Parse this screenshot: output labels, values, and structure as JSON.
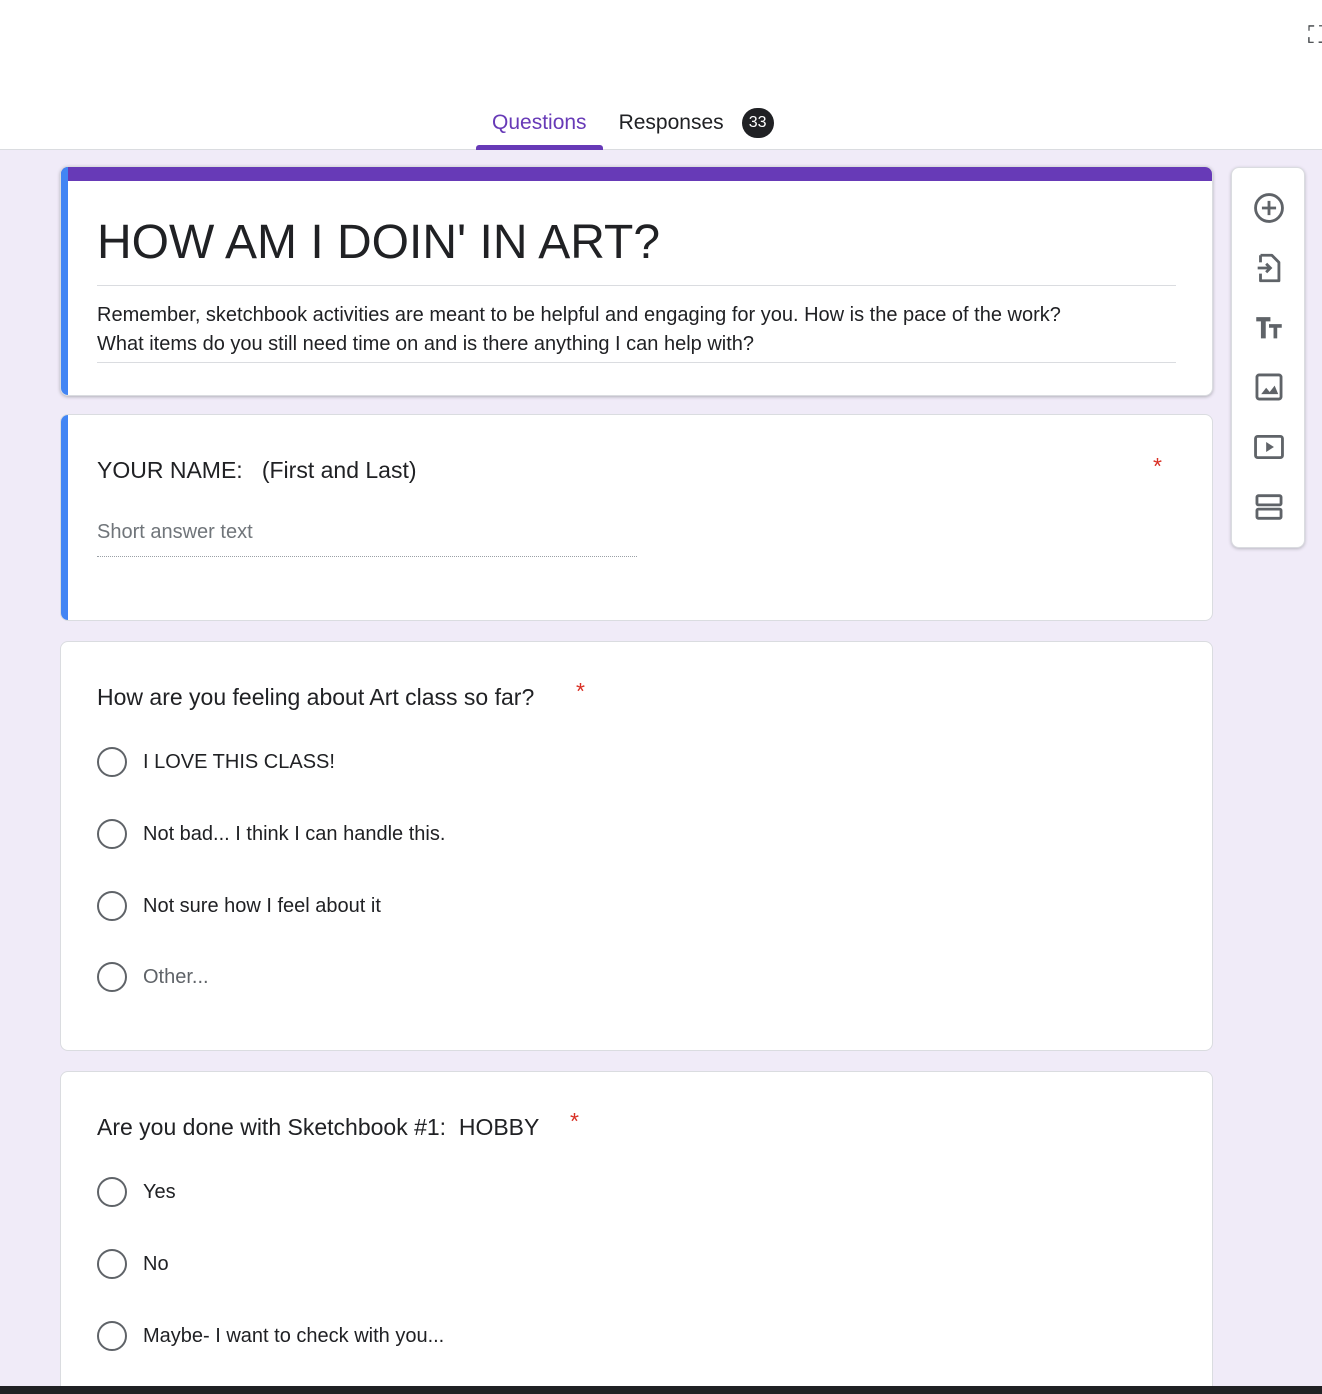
{
  "tabs": {
    "questions": "Questions",
    "responses": "Responses",
    "responses_count": "33"
  },
  "form": {
    "title": "HOW AM I DOIN' IN ART?",
    "description_line1": "Remember, sketchbook activities are meant to be helpful and engaging for you. How is the pace of the work?",
    "description_line2": "What items do you still need time on and is there anything I can help with?"
  },
  "questions": [
    {
      "title": "YOUR NAME:   (First and Last)",
      "required_mark": "*",
      "placeholder": "Short answer text"
    },
    {
      "title": "How are you feeling about Art class so far?",
      "required_mark": "*",
      "options": [
        "I LOVE THIS CLASS!",
        "Not bad... I think I can handle this.",
        "Not sure how I feel about it",
        "Other..."
      ]
    },
    {
      "title": "Are you done with Sketchbook #1:  HOBBY",
      "required_mark": "*",
      "options": [
        "Yes",
        "No",
        "Maybe- I want to check with you..."
      ]
    }
  ],
  "toolbar_icons": [
    "add-question-icon",
    "import-questions-icon",
    "add-title-icon",
    "add-image-icon",
    "add-video-icon",
    "add-section-icon"
  ],
  "colors": {
    "accent": "#673ab7",
    "focus_blue": "#4285f4",
    "background": "#f0ebf8",
    "required_red": "#d93025"
  }
}
